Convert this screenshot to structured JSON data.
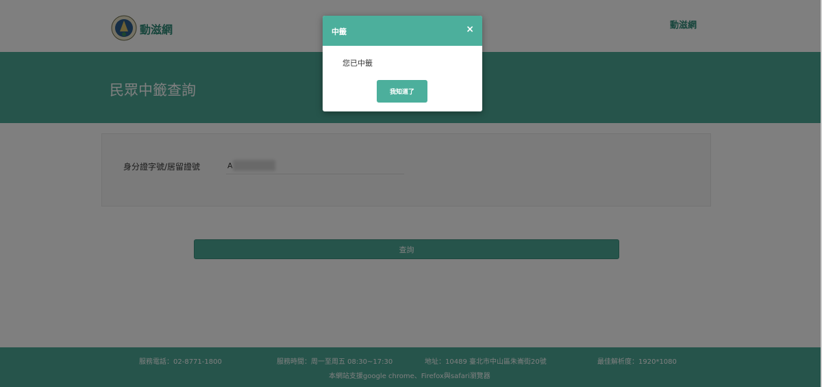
{
  "header": {
    "brand": "動滋網",
    "nav_link": "動滋網"
  },
  "banner": {
    "title": "民眾中籤查詢"
  },
  "form": {
    "id_label": "身分證字號/居留證號",
    "id_value": "A",
    "query_button": "查詢"
  },
  "footer": {
    "phone": "服務電話：02-8771-1800",
    "hours": "服務時間：周一至周五 08:30~17:30",
    "address": "地址：10489 臺北市中山區朱崙街20號",
    "resolution": "最佳解析度：1920*1080",
    "browser_note": "本網站支援google chrome、Firefox與safari瀏覽器"
  },
  "modal": {
    "title": "中籤",
    "close_symbol": "×",
    "message": "您已中籤",
    "ack_button": "我知道了"
  },
  "colors": {
    "accent": "#4ca896",
    "modal_header": "#4caf9c"
  }
}
